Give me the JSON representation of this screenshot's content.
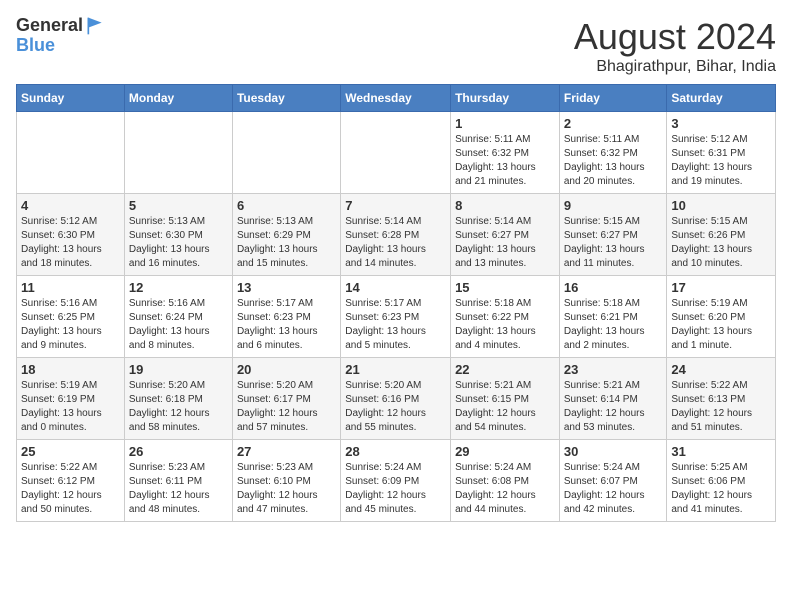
{
  "logo": {
    "general": "General",
    "blue": "Blue"
  },
  "title": "August 2024",
  "subtitle": "Bhagirathpur, Bihar, India",
  "days_of_week": [
    "Sunday",
    "Monday",
    "Tuesday",
    "Wednesday",
    "Thursday",
    "Friday",
    "Saturday"
  ],
  "weeks": [
    [
      {
        "day": "",
        "info": ""
      },
      {
        "day": "",
        "info": ""
      },
      {
        "day": "",
        "info": ""
      },
      {
        "day": "",
        "info": ""
      },
      {
        "day": "1",
        "info": "Sunrise: 5:11 AM\nSunset: 6:32 PM\nDaylight: 13 hours\nand 21 minutes."
      },
      {
        "day": "2",
        "info": "Sunrise: 5:11 AM\nSunset: 6:32 PM\nDaylight: 13 hours\nand 20 minutes."
      },
      {
        "day": "3",
        "info": "Sunrise: 5:12 AM\nSunset: 6:31 PM\nDaylight: 13 hours\nand 19 minutes."
      }
    ],
    [
      {
        "day": "4",
        "info": "Sunrise: 5:12 AM\nSunset: 6:30 PM\nDaylight: 13 hours\nand 18 minutes."
      },
      {
        "day": "5",
        "info": "Sunrise: 5:13 AM\nSunset: 6:30 PM\nDaylight: 13 hours\nand 16 minutes."
      },
      {
        "day": "6",
        "info": "Sunrise: 5:13 AM\nSunset: 6:29 PM\nDaylight: 13 hours\nand 15 minutes."
      },
      {
        "day": "7",
        "info": "Sunrise: 5:14 AM\nSunset: 6:28 PM\nDaylight: 13 hours\nand 14 minutes."
      },
      {
        "day": "8",
        "info": "Sunrise: 5:14 AM\nSunset: 6:27 PM\nDaylight: 13 hours\nand 13 minutes."
      },
      {
        "day": "9",
        "info": "Sunrise: 5:15 AM\nSunset: 6:27 PM\nDaylight: 13 hours\nand 11 minutes."
      },
      {
        "day": "10",
        "info": "Sunrise: 5:15 AM\nSunset: 6:26 PM\nDaylight: 13 hours\nand 10 minutes."
      }
    ],
    [
      {
        "day": "11",
        "info": "Sunrise: 5:16 AM\nSunset: 6:25 PM\nDaylight: 13 hours\nand 9 minutes."
      },
      {
        "day": "12",
        "info": "Sunrise: 5:16 AM\nSunset: 6:24 PM\nDaylight: 13 hours\nand 8 minutes."
      },
      {
        "day": "13",
        "info": "Sunrise: 5:17 AM\nSunset: 6:23 PM\nDaylight: 13 hours\nand 6 minutes."
      },
      {
        "day": "14",
        "info": "Sunrise: 5:17 AM\nSunset: 6:23 PM\nDaylight: 13 hours\nand 5 minutes."
      },
      {
        "day": "15",
        "info": "Sunrise: 5:18 AM\nSunset: 6:22 PM\nDaylight: 13 hours\nand 4 minutes."
      },
      {
        "day": "16",
        "info": "Sunrise: 5:18 AM\nSunset: 6:21 PM\nDaylight: 13 hours\nand 2 minutes."
      },
      {
        "day": "17",
        "info": "Sunrise: 5:19 AM\nSunset: 6:20 PM\nDaylight: 13 hours\nand 1 minute."
      }
    ],
    [
      {
        "day": "18",
        "info": "Sunrise: 5:19 AM\nSunset: 6:19 PM\nDaylight: 13 hours\nand 0 minutes."
      },
      {
        "day": "19",
        "info": "Sunrise: 5:20 AM\nSunset: 6:18 PM\nDaylight: 12 hours\nand 58 minutes."
      },
      {
        "day": "20",
        "info": "Sunrise: 5:20 AM\nSunset: 6:17 PM\nDaylight: 12 hours\nand 57 minutes."
      },
      {
        "day": "21",
        "info": "Sunrise: 5:20 AM\nSunset: 6:16 PM\nDaylight: 12 hours\nand 55 minutes."
      },
      {
        "day": "22",
        "info": "Sunrise: 5:21 AM\nSunset: 6:15 PM\nDaylight: 12 hours\nand 54 minutes."
      },
      {
        "day": "23",
        "info": "Sunrise: 5:21 AM\nSunset: 6:14 PM\nDaylight: 12 hours\nand 53 minutes."
      },
      {
        "day": "24",
        "info": "Sunrise: 5:22 AM\nSunset: 6:13 PM\nDaylight: 12 hours\nand 51 minutes."
      }
    ],
    [
      {
        "day": "25",
        "info": "Sunrise: 5:22 AM\nSunset: 6:12 PM\nDaylight: 12 hours\nand 50 minutes."
      },
      {
        "day": "26",
        "info": "Sunrise: 5:23 AM\nSunset: 6:11 PM\nDaylight: 12 hours\nand 48 minutes."
      },
      {
        "day": "27",
        "info": "Sunrise: 5:23 AM\nSunset: 6:10 PM\nDaylight: 12 hours\nand 47 minutes."
      },
      {
        "day": "28",
        "info": "Sunrise: 5:24 AM\nSunset: 6:09 PM\nDaylight: 12 hours\nand 45 minutes."
      },
      {
        "day": "29",
        "info": "Sunrise: 5:24 AM\nSunset: 6:08 PM\nDaylight: 12 hours\nand 44 minutes."
      },
      {
        "day": "30",
        "info": "Sunrise: 5:24 AM\nSunset: 6:07 PM\nDaylight: 12 hours\nand 42 minutes."
      },
      {
        "day": "31",
        "info": "Sunrise: 5:25 AM\nSunset: 6:06 PM\nDaylight: 12 hours\nand 41 minutes."
      }
    ]
  ]
}
